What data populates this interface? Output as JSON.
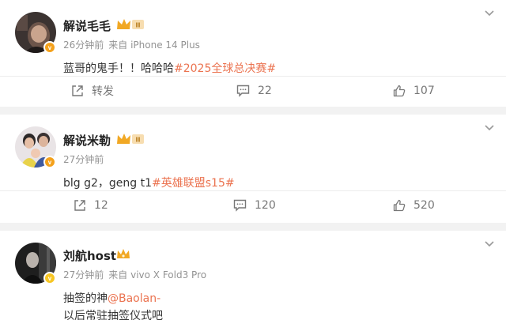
{
  "comments": [
    {
      "author": "解说毛毛",
      "level_badge": "II",
      "time": "26分钟前",
      "source": "来自 iPhone 14 Plus",
      "text": "蓝哥的鬼手！！哈哈哈",
      "topic": "#2025全球总决赛#",
      "repost_label": "转发",
      "comment_count": "22",
      "like_count": "107"
    },
    {
      "author": "解说米勒",
      "level_badge": "II",
      "time": "27分钟前",
      "text": "blg g2，geng t1",
      "topic": "#英雄联盟s15#",
      "repost_count": "12",
      "comment_count": "120",
      "like_count": "520"
    },
    {
      "author": "刘航host",
      "time": "27分钟前",
      "source": "来自 vivo X Fold3 Pro",
      "text_line1": "抽签的神",
      "mention": "@Baolan-",
      "text_line2": "以后常驻抽签仪式吧"
    }
  ],
  "colors": {
    "accent": "#eb7350",
    "verified_orange": "#f4a11b",
    "verified_yellow": "#f7c623",
    "crown_gold": "#f1a824"
  }
}
